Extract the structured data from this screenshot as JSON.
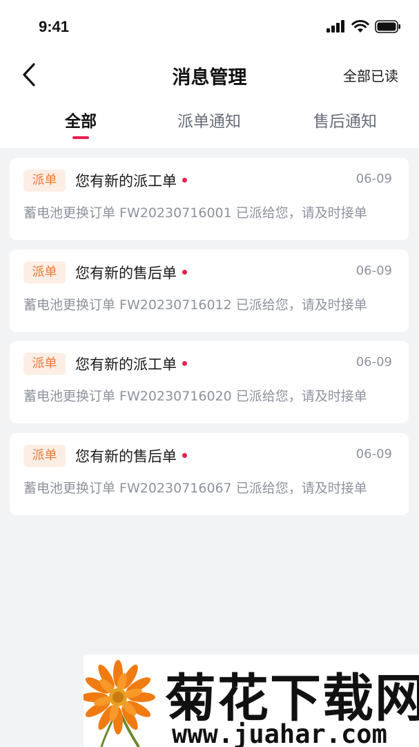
{
  "status_bar": {
    "time": "9:41",
    "icons": [
      "signal-icon",
      "wifi-icon",
      "battery-icon"
    ]
  },
  "header": {
    "back_icon": "chevron-left-icon",
    "title": "消息管理",
    "action": "全部已读"
  },
  "tabs": [
    {
      "label": "全部",
      "active": true
    },
    {
      "label": "派单通知",
      "active": false
    },
    {
      "label": "售后通知",
      "active": false
    }
  ],
  "messages": [
    {
      "badge": "派单",
      "title": "您有新的派工单",
      "date": "06-09",
      "body": "蓄电池更换订单 FW20230716001 已派给您，请及时接单",
      "unread": true
    },
    {
      "badge": "派单",
      "title": "您有新的售后单",
      "date": "06-09",
      "body": "蓄电池更换订单 FW20230716012 已派给您，请及时接单",
      "unread": true
    },
    {
      "badge": "派单",
      "title": "您有新的派工单",
      "date": "06-09",
      "body": "蓄电池更换订单 FW20230716020 已派给您，请及时接单",
      "unread": true
    },
    {
      "badge": "派单",
      "title": "您有新的售后单",
      "date": "06-09",
      "body": "蓄电池更换订单 FW20230716067 已派给您，请及时接单",
      "unread": true
    }
  ],
  "watermark": {
    "title": "菊花下载网",
    "url": "www.juahar.com"
  },
  "colors": {
    "accent": "#e8204e",
    "badge_text": "#ee7a33",
    "badge_bg": "#fdeee5",
    "page_bg": "#f2f3f5"
  }
}
